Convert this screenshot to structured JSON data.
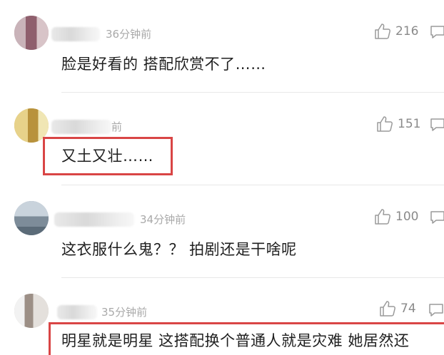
{
  "comments": [
    {
      "time": "36分钟前",
      "likes": "216",
      "text": "脸是好看的 搭配欣赏不了……",
      "highlighted": false
    },
    {
      "time": "前",
      "likes": "151",
      "text": "又土又壮……",
      "highlighted": true
    },
    {
      "time": "34分钟前",
      "likes": "100",
      "text": "这衣服什么鬼？？ 拍剧还是干啥呢",
      "highlighted": false
    },
    {
      "time": "35分钟前",
      "likes": "74",
      "text": "明星就是明星 这搭配换个普通人就是灾难 她居然还",
      "highlighted": true
    }
  ],
  "colors": {
    "highlight_border": "#d94545",
    "meta_text": "#a9a9a9",
    "body_text": "#1f1f1f",
    "divider": "#e8e8e8"
  },
  "icons": {
    "like": "thumbs-up-icon",
    "reply": "comment-bubble-icon"
  }
}
